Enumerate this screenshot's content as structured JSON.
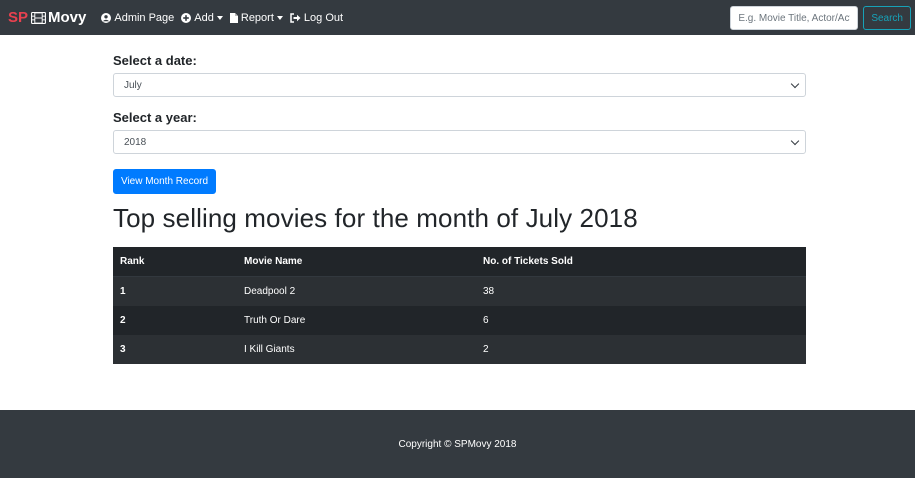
{
  "navbar": {
    "brand_sp": "SP",
    "brand_movy": "Movy",
    "items": [
      {
        "label": "Admin Page",
        "icon": "user-circle-icon",
        "dropdown": false
      },
      {
        "label": "Add",
        "icon": "plus-circle-icon",
        "dropdown": true
      },
      {
        "label": "Report",
        "icon": "file-icon",
        "dropdown": true
      },
      {
        "label": "Log Out",
        "icon": "sign-out-icon",
        "dropdown": false
      }
    ],
    "search_placeholder": "E.g. Movie Title, Actor/Actress",
    "search_button": "Search"
  },
  "form": {
    "date_label": "Select a date:",
    "date_value": "July",
    "year_label": "Select a year:",
    "year_value": "2018",
    "submit_label": "View Month Record"
  },
  "page": {
    "title": "Top selling movies for the month of July 2018"
  },
  "table": {
    "headers": [
      "Rank",
      "Movie Name",
      "No. of Tickets Sold"
    ],
    "rows": [
      [
        "1",
        "Deadpool 2",
        "38"
      ],
      [
        "2",
        "Truth Or Dare",
        "6"
      ],
      [
        "3",
        "I Kill Giants",
        "2"
      ]
    ]
  },
  "footer": {
    "copyright": "Copyright © SPMovy 2018"
  },
  "colors": {
    "navbar_bg": "#343a40",
    "brand_accent": "#e8414f",
    "primary": "#007bff",
    "search_outline": "#17a2b8",
    "table_dark": "#212529"
  }
}
